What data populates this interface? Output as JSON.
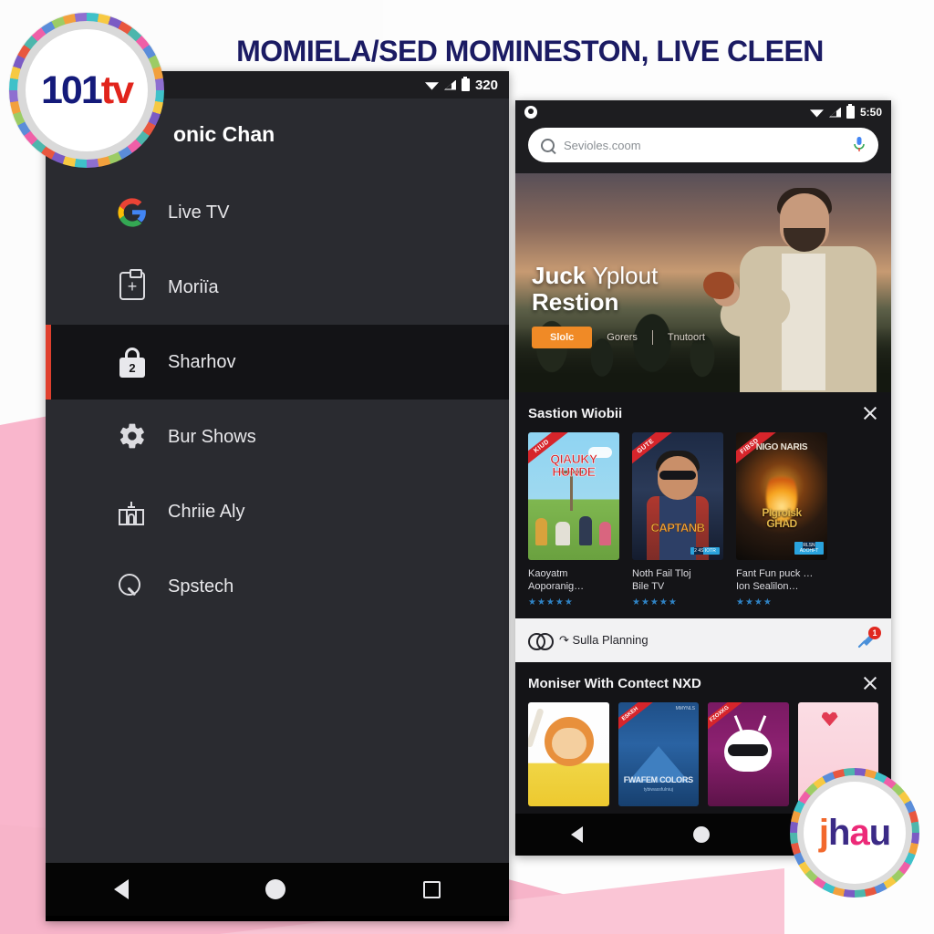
{
  "page": {
    "title": "MOMIELA/SED MOMINESTON, LIVE CLEEN"
  },
  "brand_logo": {
    "name": "101tv-logo",
    "part1": "101",
    "part2": "tv",
    "color1": "#141a7a",
    "color2": "#e1241c"
  },
  "watermark_logo": {
    "name": "jhau-logo",
    "letters": [
      "j",
      "h",
      "a",
      "u"
    ],
    "colors": [
      "#f2682c",
      "#3b2a86",
      "#ec2a78",
      "#3b2a86"
    ]
  },
  "left_phone": {
    "statusbar": {
      "time": "320",
      "icons": [
        "wifi-icon",
        "signal-icon",
        "battery-icon"
      ]
    },
    "drawer": {
      "header": "onic Chan",
      "items": [
        {
          "label": "Live TV",
          "icon": "google-g-icon",
          "active": false
        },
        {
          "label": "Moriïa",
          "icon": "clipboard-add-icon",
          "active": false
        },
        {
          "label": "Sharhov",
          "icon": "lock-icon",
          "active": true,
          "badge": "2"
        },
        {
          "label": "Bur Shows",
          "icon": "gear-icon",
          "active": false
        },
        {
          "label": "Chriie Aly",
          "icon": "building-icon",
          "active": false
        },
        {
          "label": "Spstech",
          "icon": "search-icon",
          "active": false
        }
      ],
      "active_accent": "#e0402e"
    },
    "navbar": {
      "back": "back-icon",
      "home": "home-icon",
      "recents": "recents-icon"
    }
  },
  "right_phone": {
    "statusbar": {
      "time": "5:50",
      "left_icon": "clock-icon"
    },
    "search": {
      "placeholder": "Sevioles.coom",
      "search_icon": "search-icon",
      "mic_icon": "mic-icon"
    },
    "hero": {
      "line1_a": "Juck",
      "line1_b": "Yplout",
      "line2": "Restion",
      "button": "Slolc",
      "link1": "Gorers",
      "link2": "Tnutoort",
      "button_color": "#f08a26"
    },
    "section1": {
      "title": "Sastion Wiobii",
      "close_icon": "close-icon",
      "cards": [
        {
          "poster_ribbon": "KIUD",
          "poster_title": "QIAUKY\nHUNDE",
          "title": "Kaoyatm\nAoporanig…",
          "stars": "★★★★★",
          "rating": 5
        },
        {
          "poster_ribbon": "GUTE",
          "poster_title": "CAPTANB",
          "badge_top": "2 4S",
          "badge_bottom": "IOTR",
          "title": "Noth Fail Tloj\nBile TV",
          "stars": "★★★★★",
          "rating": 5
        },
        {
          "poster_ribbon": "FIBSD",
          "poster_top": "NIGO NARIS",
          "poster_title": "PIgroisk\nGHAD",
          "badge_top": "RLSN",
          "badge_bottom": "ADOHFT",
          "title": "Fant Fun puck …\nIon Sealilon…",
          "stars": "★★★★",
          "rating": 4
        }
      ]
    },
    "planning_bar": {
      "label": "↷ Sulla Planning",
      "rings_icon": "rings-icon",
      "pin_icon": "pin-icon",
      "badge": "1",
      "badge_color": "#e0281f"
    },
    "section2": {
      "title": "Moniser With Contect NXD",
      "close_icon": "close-icon",
      "cards": [
        {
          "name": "bee-character-card",
          "ribbon": ""
        },
        {
          "name": "mountain-card",
          "ribbon": "ESKEH",
          "title": "FWAFEM COLORS",
          "subtitle": "tybiwassfulniuj",
          "corner": "MMYNLS"
        },
        {
          "name": "alien-character-card",
          "ribbon": "FZOXKG"
        },
        {
          "name": "heart-card",
          "ribbon": ""
        }
      ]
    },
    "navbar": {
      "back": "back-icon",
      "home": "home-icon",
      "recents": "recents-icon"
    }
  }
}
